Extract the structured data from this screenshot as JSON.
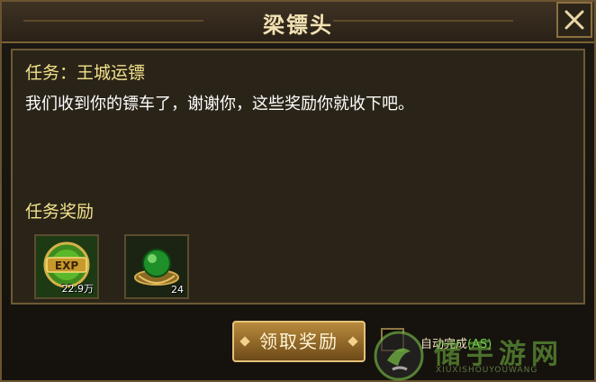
{
  "dialog": {
    "title": "梁镖头",
    "close_icon": "close-x-icon"
  },
  "quest": {
    "title": "任务：王城运镖",
    "text": "我们收到你的镖车了，谢谢你，这些奖励你就收下吧。"
  },
  "rewards": {
    "title": "任务奖励",
    "items": [
      {
        "icon": "exp-icon",
        "count": "22.9万"
      },
      {
        "icon": "green-orb-icon",
        "count": "24"
      }
    ]
  },
  "actions": {
    "claim_label": "领取奖励",
    "auto_label": "自动完成",
    "auto_hotkey": "(AS)"
  },
  "watermark": {
    "text": "储手游网",
    "sub": "XIUXISHOUYOUWANG"
  },
  "colors": {
    "accent_gold": "#f1e08a",
    "border": "#6d5a34",
    "hotkey_green": "#6bd84b"
  }
}
